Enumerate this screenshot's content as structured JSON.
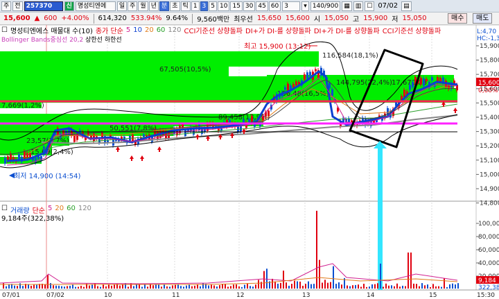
{
  "toolbar1": {
    "item1": "주",
    "item2": "전",
    "code": "257370",
    "market_badge": "신",
    "stock_name": "명성티엔에",
    "periods": [
      "일",
      "주",
      "월",
      "년",
      "분",
      "초",
      "틱",
      "1",
      "3",
      "5",
      "10",
      "15",
      "30",
      "45",
      "60"
    ],
    "period_selected": "분",
    "interval_value": "3",
    "zoom": "140/900",
    "date": "07/02"
  },
  "toolbar2": {
    "price": "15,600",
    "change_arrow": "▲",
    "change": "600",
    "change_pct": "+4.00%",
    "volume": "614,320",
    "vol_ratio": "533.94%",
    "turnover_pct": "9.64%",
    "amount": "9,560백만",
    "best_sell_label": "최우선",
    "best_sell": "15,650",
    "best_buy": "15,600",
    "open_label": "시",
    "open": "15,050",
    "high_label": "고",
    "high": "15,900",
    "low_label": "저",
    "low": "15,050",
    "buy_btn": "매수",
    "sell_btn": "매도"
  },
  "legend": {
    "title": "명성티엔에스 매물대 수(10)",
    "ma_label": "종가 단순",
    "ma_periods": [
      "5",
      "10",
      "20",
      "60",
      "120"
    ],
    "cci_label": "CCI기준선 상향돌파",
    "di_label": "DI+가 DI-를 상향돌파",
    "di_label2": "DI+가 DI-를 상향돌파",
    "cci_label2": "CCI기준선 상향돌파",
    "bollinger": "Bollinger Bands중심선 20,2",
    "upper": "상한선",
    "lower": "하한선",
    "right_top": "L:4,70",
    "right_top2": "HC:-1,30"
  },
  "annotations": {
    "high": "최고 15,900 (13:12)",
    "low": "최저 14,900 (14:54)"
  },
  "volume_profile": [
    {
      "label": "67,505(10,5%)"
    },
    {
      "label": "7,669(1,2%)"
    },
    {
      "label": "89,458(13,9%)"
    },
    {
      "label": "50,551(7,8%)"
    },
    {
      "label": "23,57(3,7%)"
    },
    {
      "label": "15,69(2,4%)"
    },
    {
      "label": "116,584(18,1%)"
    },
    {
      "label": "144,795(22,4%)"
    },
    {
      "label": "106,48(16,5%)"
    },
    {
      "label": "17,670,08"
    }
  ],
  "price_axis": [
    "15,900",
    "15,800",
    "15,700",
    "15,600",
    "15,500",
    "15,400",
    "15,300",
    "15,200",
    "15,100",
    "15,000",
    "14,900",
    "14,800"
  ],
  "price_current": "15,600",
  "price_current_pct": "0,00%",
  "volume_panel": {
    "label": "거래량",
    "ma_label": "단순",
    "ma_periods": [
      "5",
      "20",
      "60",
      "120"
    ],
    "value": "9,184주(322,38%)",
    "axis": [
      "100,000",
      "80,000",
      "60,000",
      "40,000",
      "20,000"
    ],
    "current": "9,184",
    "current_pct": "322,38"
  },
  "x_axis": [
    "07/01",
    "07/02",
    "10",
    "11",
    "12",
    "13",
    "14",
    "15",
    "15:30"
  ],
  "colors": {
    "up": "#e0000f",
    "down": "#0b4fd0",
    "profile": "#00ee00",
    "ma5": "#d01f8f",
    "ma20": "#e07b1a",
    "ma60": "#2aa02a",
    "ma120": "#888888",
    "cyan": "#33e6ff"
  }
}
